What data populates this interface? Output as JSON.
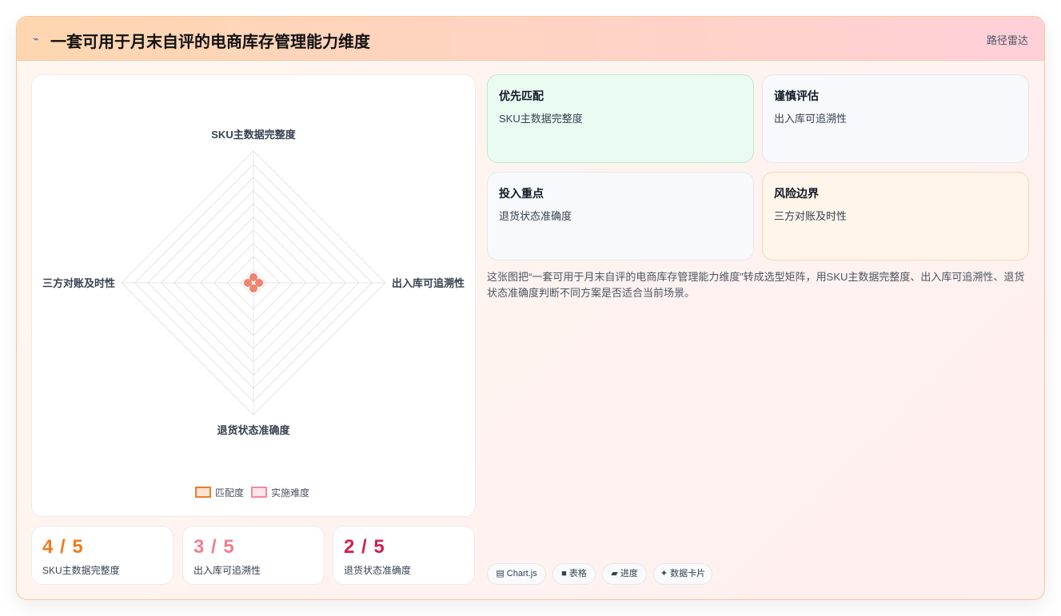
{
  "header": {
    "icon": "wave-icon",
    "title": "一套可用于月末自评的电商库存管理能力维度",
    "tag": "路径雷达"
  },
  "chart_data": {
    "type": "radar",
    "axes": [
      "SKU主数据完整度",
      "出入库可追溯性",
      "退货状态准确度",
      "三方对账及时性"
    ],
    "max": 5,
    "levels": 10,
    "series": [
      {
        "name": "匹配度",
        "values": [
          0,
          0,
          0,
          0
        ],
        "color": "#f07a2a"
      },
      {
        "name": "实施难度",
        "values": [
          0,
          0,
          0,
          0
        ],
        "color": "#f08aa0"
      }
    ],
    "legend_position": "bottom"
  },
  "stats": [
    {
      "value": "4 / 5",
      "label": "SKU主数据完整度",
      "color": "#f07a1e"
    },
    {
      "value": "3 / 5",
      "label": "出入库可追溯性",
      "color": "#ef7f8f"
    },
    {
      "value": "2 / 5",
      "label": "退货状态准确度",
      "color": "#d11f4f"
    }
  ],
  "matrix": [
    {
      "title": "优先匹配",
      "body": "SKU主数据完整度"
    },
    {
      "title": "谨慎评估",
      "body": "出入库可追溯性"
    },
    {
      "title": "投入重点",
      "body": "退货状态准确度"
    },
    {
      "title": "风险边界",
      "body": "三方对账及时性"
    }
  ],
  "description": "这张图把“一套可用于月末自评的电商库存管理能力维度”转成选型矩阵，用SKU主数据完整度、出入库可追溯性、退货状态准确度判断不同方案是否适合当前场景。",
  "tags": [
    {
      "icon": "chart-icon",
      "label": "Chart.js"
    },
    {
      "icon": "table-icon",
      "label": "表格"
    },
    {
      "icon": "progress-icon",
      "label": "进度"
    },
    {
      "icon": "sparkle-icon",
      "label": "数据卡片"
    }
  ]
}
